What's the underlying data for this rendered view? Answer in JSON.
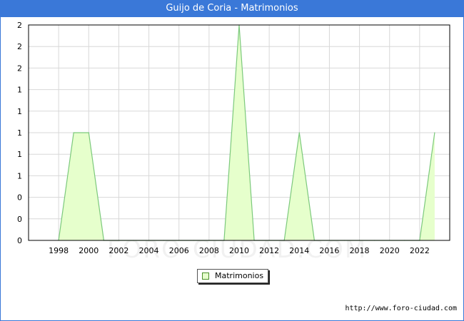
{
  "page": {
    "title": "Guijo de Coria - Matrimonios",
    "source_url": "http://www.foro-ciudad.com",
    "watermark": "FORO-CIUDAD.COM"
  },
  "chart_data": {
    "type": "area",
    "title": "Guijo de Coria - Matrimonios",
    "xlabel": "",
    "ylabel": "",
    "x": [
      1998,
      1999,
      2000,
      2001,
      2002,
      2003,
      2004,
      2005,
      2006,
      2007,
      2008,
      2009,
      2010,
      2011,
      2012,
      2013,
      2014,
      2015,
      2016,
      2017,
      2018,
      2019,
      2020,
      2021,
      2022,
      2023
    ],
    "series": [
      {
        "name": "Matrimonios",
        "values": [
          0,
          1,
          1,
          0,
          0,
          0,
          0,
          0,
          0,
          0,
          0,
          0,
          2,
          0,
          0,
          0,
          1,
          0,
          0,
          0,
          0,
          0,
          0,
          0,
          0,
          1
        ]
      }
    ],
    "x_ticks": [
      "1998",
      "2000",
      "2002",
      "2004",
      "2006",
      "2008",
      "2010",
      "2012",
      "2014",
      "2016",
      "2018",
      "2020",
      "2022"
    ],
    "y_ticks": [
      "0",
      "0",
      "0",
      "1",
      "1",
      "1",
      "1",
      "1",
      "2",
      "2",
      "2"
    ],
    "ylim": [
      0,
      2
    ],
    "grid": true,
    "legend_position": "bottom-center",
    "colors": {
      "fill": "#e6ffcc",
      "line": "#7cc97c",
      "grid": "#d8d8d8",
      "header": "#3a78d8"
    }
  }
}
